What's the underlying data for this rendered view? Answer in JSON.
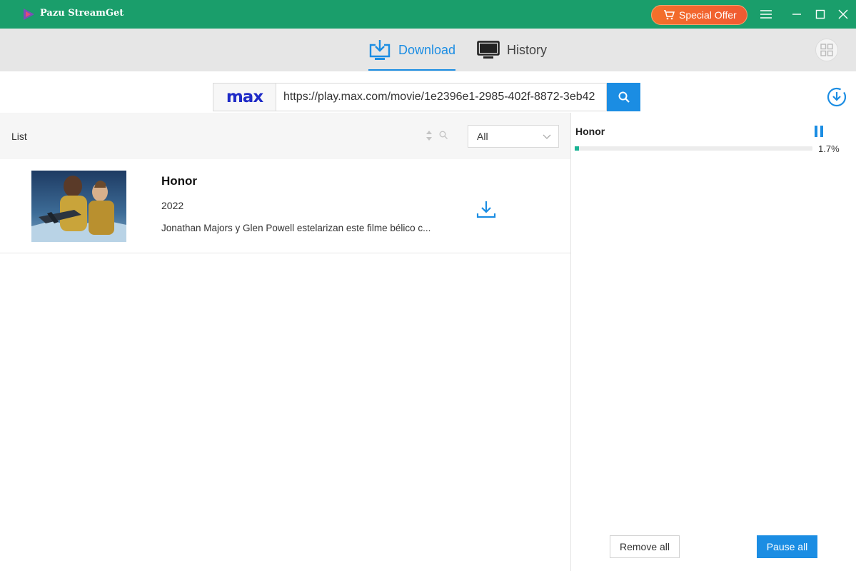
{
  "app": {
    "title": "Pazu StreamGet",
    "offer_label": "Special Offer"
  },
  "tabs": {
    "download": "Download",
    "history": "History"
  },
  "search": {
    "source": "max",
    "url": "https://play.max.com/movie/1e2396e1-2985-402f-8872-3eb42"
  },
  "list": {
    "header": "List",
    "filter": "All",
    "items": [
      {
        "title": "Honor",
        "year": "2022",
        "description": "Jonathan Majors y Glen Powell estelarizan este filme bélico c..."
      }
    ]
  },
  "downloads": {
    "task": {
      "title": "Honor",
      "progress_pct": 1.7,
      "progress_label": "1.7%"
    },
    "remove_all": "Remove all",
    "pause_all": "Pause all"
  },
  "colors": {
    "titlebar": "#1a9e6b",
    "accent": "#1b8de3",
    "offer": "#f05a32",
    "progress": "#1ab394",
    "max_brand": "#1f2bc7"
  },
  "icons": [
    "app-logo-icon",
    "cart-icon",
    "menu-icon",
    "minimize-icon",
    "maximize-icon",
    "close-icon",
    "download-tab-icon",
    "monitor-icon",
    "grid-icon",
    "search-icon",
    "download-circle-icon",
    "sort-icon",
    "chevron-down-icon",
    "download-icon",
    "pause-icon"
  ]
}
